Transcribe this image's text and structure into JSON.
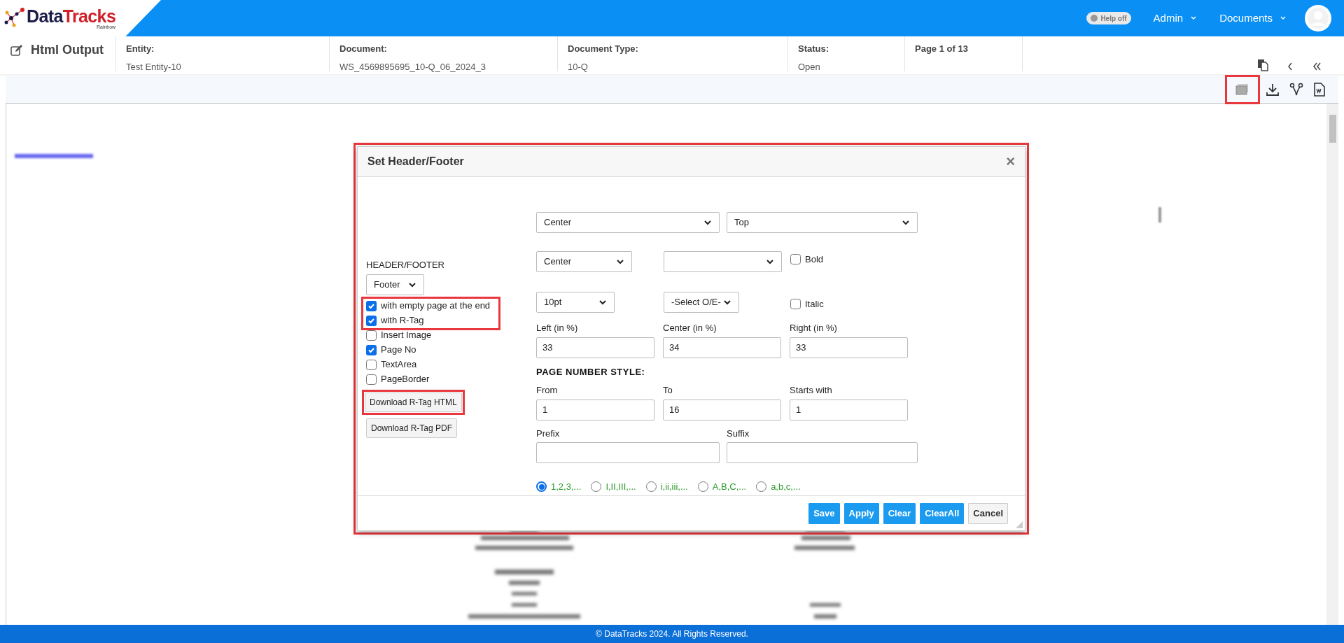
{
  "brand": {
    "name_first": "Data",
    "name_second": "Tracks",
    "tagline": "Rainbow"
  },
  "top_nav": {
    "help_toggle": {
      "label": "Help off",
      "on": false
    },
    "menus": [
      "Admin",
      "Documents"
    ]
  },
  "page_title": "Html Output",
  "info_fields": [
    {
      "label": "Entity:",
      "value": "Test Entity-10"
    },
    {
      "label": "Document:",
      "value": "WS_4569895695_10-Q_06_2024_3"
    },
    {
      "label": "Document Type:",
      "value": "10-Q"
    },
    {
      "label": "Status:",
      "value": "Open"
    },
    {
      "label": "Page 1 of 13"
    }
  ],
  "dialog": {
    "title": "Set Header/Footer",
    "close": "×",
    "position_selects": [
      "Center",
      "Top"
    ],
    "header_footer_label": "HEADER/FOOTER",
    "header_footer_select": "Footer",
    "options": [
      {
        "label": "with empty page at the end",
        "checked": true
      },
      {
        "label": "with R-Tag",
        "checked": true
      },
      {
        "label": "Insert Image",
        "checked": false
      },
      {
        "label": "Page No",
        "checked": true
      },
      {
        "label": "TextArea",
        "checked": false
      },
      {
        "label": "PageBorder",
        "checked": false
      }
    ],
    "download_buttons": [
      "Download R-Tag HTML",
      "Download R-Tag PDF"
    ],
    "align_select": "Center",
    "size_select": "10pt",
    "odd_even_select": "-Select O/E-",
    "style_checks": [
      {
        "label": "Bold",
        "checked": false
      },
      {
        "label": "Italic",
        "checked": false
      }
    ],
    "percent_fields": [
      {
        "label": "Left (in %)",
        "value": "33"
      },
      {
        "label": "Center (in %)",
        "value": "34"
      },
      {
        "label": "Right (in %)",
        "value": "33"
      }
    ],
    "page_number_style_heading": "PAGE NUMBER STYLE:",
    "range_fields": [
      {
        "label": "From",
        "value": "1"
      },
      {
        "label": "To",
        "value": "16"
      },
      {
        "label": "Starts with",
        "value": "1"
      }
    ],
    "affix_fields": [
      {
        "label": "Prefix"
      },
      {
        "label": "Suffix"
      }
    ],
    "number_formats": [
      {
        "label": "1,2,3,...",
        "selected": true
      },
      {
        "label": "I,II,III,...",
        "selected": false
      },
      {
        "label": "i,ii,iii,...",
        "selected": false
      },
      {
        "label": "A,B,C,...",
        "selected": false
      },
      {
        "label": "a,b,c,...",
        "selected": false
      }
    ],
    "buttons": [
      {
        "label": "Save",
        "kind": "primary"
      },
      {
        "label": "Apply",
        "kind": "primary"
      },
      {
        "label": "Clear",
        "kind": "primary"
      },
      {
        "label": "ClearAll",
        "kind": "primary"
      },
      {
        "label": "Cancel",
        "kind": "secondary"
      }
    ]
  },
  "footer": "© DataTracks 2024. All Rights Reserved."
}
